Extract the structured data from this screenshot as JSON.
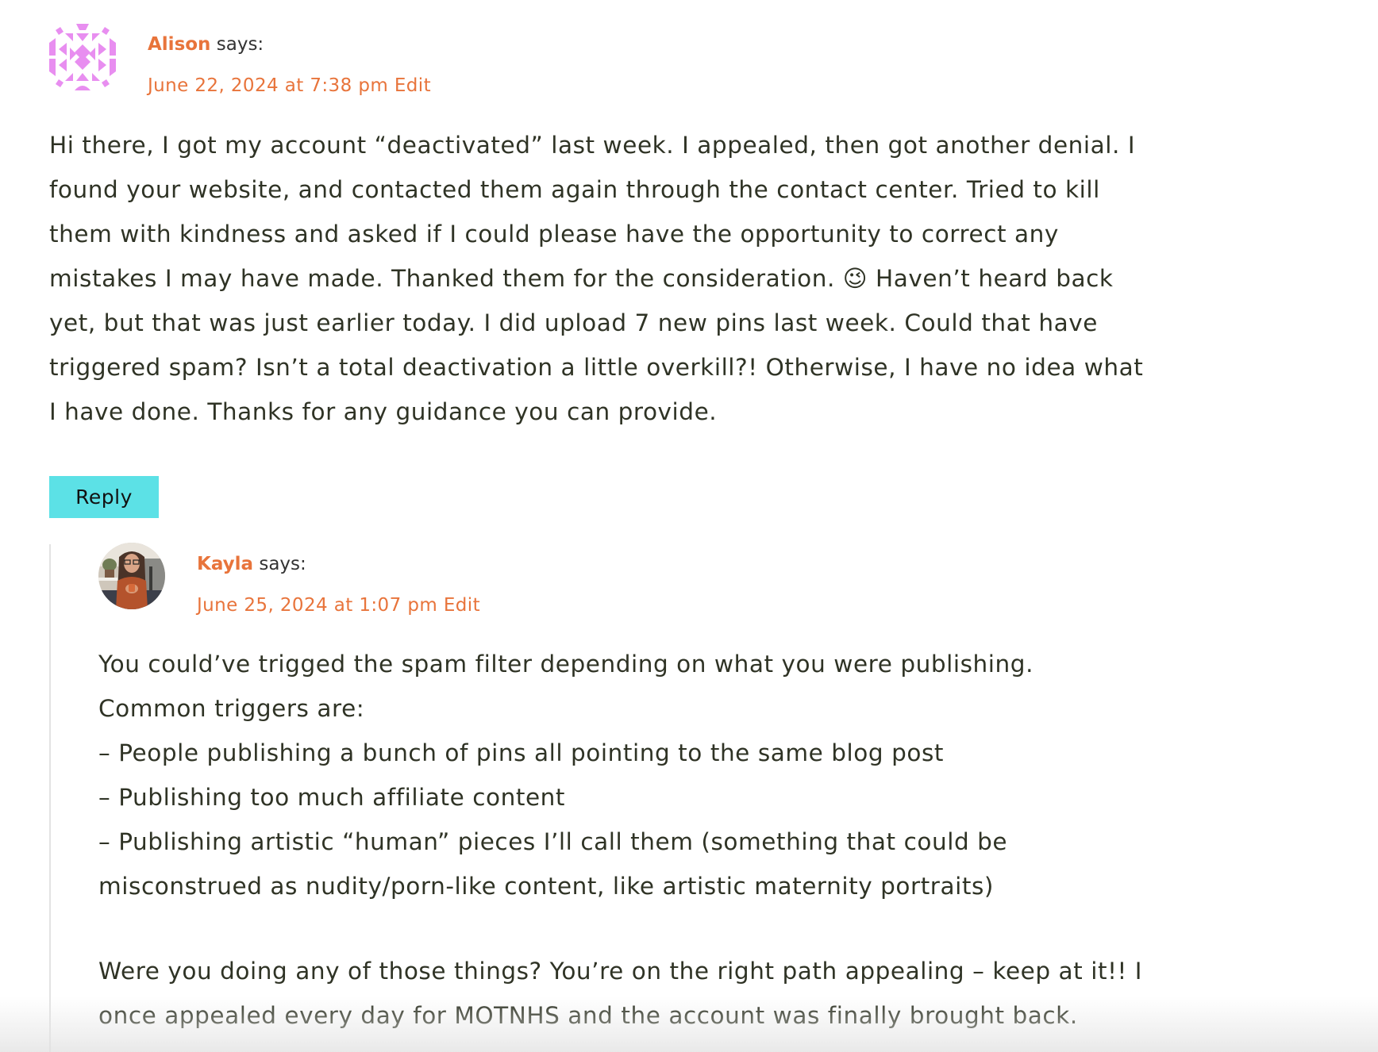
{
  "comments": [
    {
      "author": "Alison",
      "says": "says:",
      "date": "June 22, 2024 at 7:38 pm",
      "edit_label": "Edit",
      "avatar": "identicon-avatar",
      "avatar_color": "#e88ef0",
      "body": [
        "Hi there, I got my account “deactivated” last week. I appealed, then got another denial. I",
        "found your website, and contacted them again through the contact center. Tried to kill",
        "them with kindness and asked if I could please have the opportunity to correct any",
        "mistakes I may have made. Thanked them for the consideration. 😉 Haven’t heard back",
        "yet, but that was just earlier today. I did upload 7 new pins last week. Could that have",
        "triggered spam? Isn’t a total deactivation a little overkill?! Otherwise, I have no idea what",
        "I have done. Thanks for any guidance you can provide."
      ],
      "reply_label": "Reply"
    },
    {
      "author": "Kayla",
      "says": "says:",
      "date": "June 25, 2024 at 1:07 pm",
      "edit_label": "Edit",
      "avatar": "photo-avatar",
      "body": [
        "You could’ve trigged the spam filter depending on what you were publishing.",
        "Common triggers are:",
        "– People publishing a bunch of pins all pointing to the same blog post",
        "– Publishing too much affiliate content",
        "– Publishing artistic “human” pieces I’ll call them (something that could be",
        "misconstrued as nudity/porn-like content, like artistic maternity portraits)",
        "",
        "Were you doing any of those things? You’re on the right path appealing – keep at it!! I",
        "once appealed every day for MOTNHS and the account was finally brought back."
      ]
    }
  ],
  "colors": {
    "accent": "#e8743b",
    "reply_button": "#5ce1e6",
    "text": "#2f3325"
  }
}
